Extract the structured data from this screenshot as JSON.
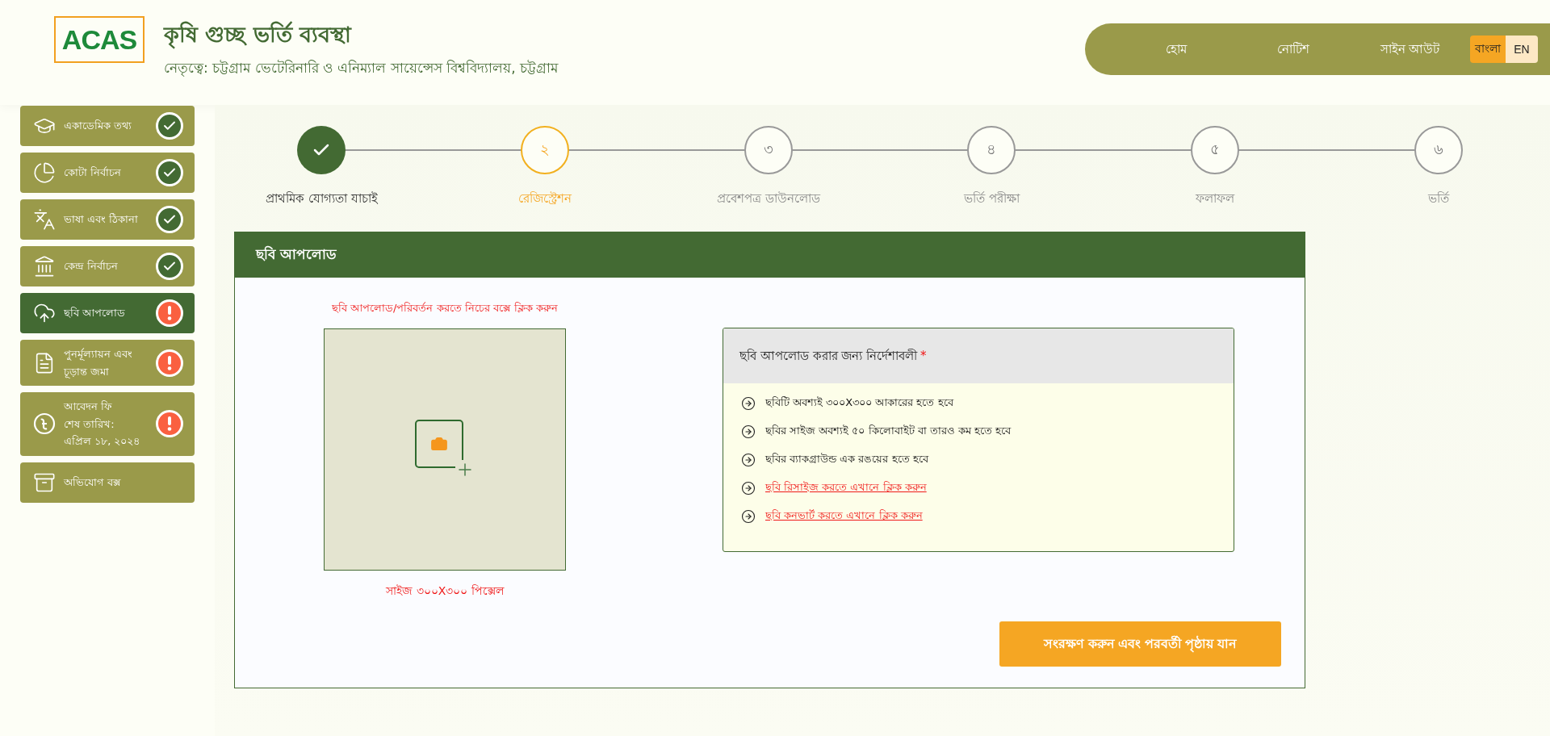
{
  "header": {
    "logo": "ACAS",
    "title": "কৃষি গুচ্ছ ভর্তি ব্যবস্থা",
    "subtitle": "নেতৃত্বে: চট্টগ্রাম ভেটেরিনারি ও এনিম্যাল সায়েন্সেস বিশ্ববিদ্যালয়, চট্টগ্রাম"
  },
  "nav": {
    "links": [
      "হোম",
      "নোটিশ",
      "সাইন আউট"
    ],
    "languages": [
      {
        "label": "বাংলা",
        "selected": true
      },
      {
        "label": "EN",
        "selected": false
      }
    ]
  },
  "sidebar": {
    "items": [
      {
        "lines": [
          "একাডেমিক তথ্য"
        ],
        "kind": "task",
        "complete": true,
        "selected": false
      },
      {
        "lines": [
          "কোটা নির্বাচন"
        ],
        "kind": "task",
        "complete": true,
        "selected": false
      },
      {
        "lines": [
          "ভাষা এবং ঠিকানা"
        ],
        "kind": "task",
        "complete": true,
        "selected": false
      },
      {
        "lines": [
          "কেন্দ্র নির্বাচন"
        ],
        "kind": "task",
        "complete": true,
        "selected": false
      },
      {
        "lines": [
          "ছবি আপলোড"
        ],
        "kind": "task",
        "complete": false,
        "selected": true
      },
      {
        "lines": [
          "পুনর্মূল্যায়ন এবং",
          "চূড়ান্ত জমা"
        ],
        "kind": "task",
        "complete": false,
        "selected": false
      },
      {
        "lines": [
          "আবেদন ফি",
          "শেষ তারিখ:",
          "এপ্রিল ১৮, ২০২৪"
        ],
        "kind": "task",
        "complete": false,
        "selected": false
      },
      {
        "lines": [
          "অভিযোগ বক্স"
        ],
        "kind": "link",
        "selected": false
      }
    ]
  },
  "steps": [
    {
      "label": "প্রাথমিক যোগ্যতা যাচাই",
      "completed": true,
      "selected": false
    },
    {
      "number": "২",
      "label": "রেজিস্ট্রেশন",
      "completed": false,
      "selected": true
    },
    {
      "number": "৩",
      "label": "প্রবেশপত্র ডাউনলোড",
      "completed": false,
      "selected": false
    },
    {
      "number": "৪",
      "label": "ভর্তি পরীক্ষা",
      "completed": false,
      "selected": false
    },
    {
      "number": "৫",
      "label": "ফলাফল",
      "completed": false,
      "selected": false
    },
    {
      "number": "৬",
      "label": "ভর্তি",
      "completed": false,
      "selected": false
    }
  ],
  "card": {
    "title": "ছবি আপলোড",
    "upload_hint": "ছবি আপলোড/পরিবর্তন করতে নিচের বক্সে ক্লিক করুন",
    "size_note": "সাইজ ৩০০X৩০০ পিক্সেল",
    "instructions": {
      "title": "ছবি আপলোড করার জন্য নির্দেশাবলী",
      "required_mark": "*",
      "items": [
        {
          "text": "ছবিটি অবশ্যই ৩০০X৩০০ আকারের হতে হবে",
          "kind": "text"
        },
        {
          "text": "ছবির সাইজ অবশ্যই ৫০ কিলোবাইট বা তারও কম হতে হবে",
          "kind": "text"
        },
        {
          "text": "ছবির ব্যাকগ্রাউন্ড এক রঙয়ের হতে হবে",
          "kind": "text"
        },
        {
          "text": "ছবি রিসাইজ করতে এখানে ক্লিক করুন",
          "kind": "link"
        },
        {
          "text": "ছবি কনভার্ট করতে এখানে ক্লিক করুন",
          "kind": "link"
        }
      ]
    },
    "save_button": "সংরক্ষণ করুন এবং পরবর্তী পৃষ্ঠায় যান"
  }
}
